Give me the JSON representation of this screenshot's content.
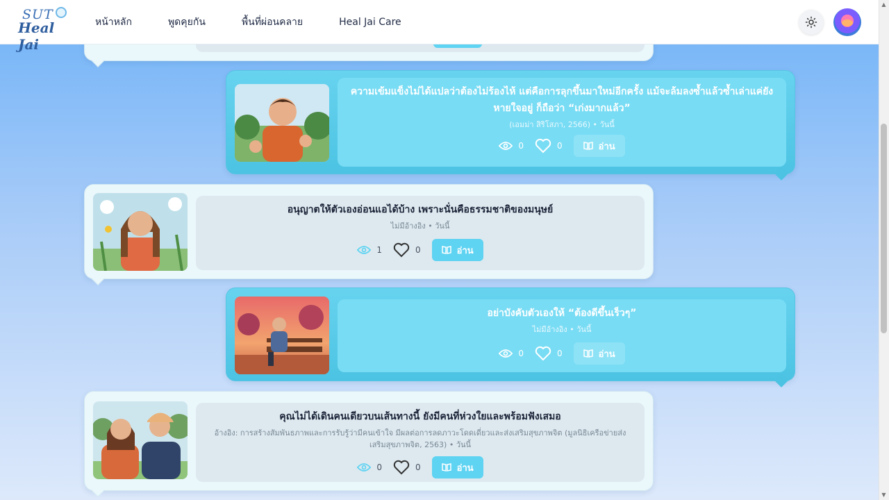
{
  "header": {
    "logo_top": "SUT",
    "logo_bottom": "Heal Jai",
    "nav": [
      "หน้าหลัก",
      "พูดคุยกัน",
      "พื้นที่ผ่อนคลาย",
      "Heal Jai Care"
    ],
    "theme_icon": "sun-icon",
    "avatar_icon": "user-avatar"
  },
  "read_label": "อ่าน",
  "cards": [
    {
      "title": "ความเข้มแข็งไม่ได้แปลว่าต้องไม่ร้องไห้ แต่คือการลุกขึ้นมาใหม่อีกครั้ง แม้จะล้มลงซ้ำแล้วซ้ำเล่าแค่ยังหายใจอยู่ ก็ถือว่า “เก่งมากแล้ว”",
      "meta": "(เอมม่า สิริโสภา, 2566) • วันนี้",
      "views": "0",
      "likes": "0"
    },
    {
      "title": "อนุญาตให้ตัวเองอ่อนแอได้บ้าง เพราะนั่นคือธรรมชาติของมนุษย์",
      "meta": "ไม่มีอ้างอิง • วันนี้",
      "views": "1",
      "likes": "0"
    },
    {
      "title": "อย่าบังคับตัวเองให้ “ต้องดีขึ้นเร็วๆ”",
      "meta": "ไม่มีอ้างอิง • วันนี้",
      "views": "0",
      "likes": "0"
    },
    {
      "title": "คุณไม่ได้เดินคนเดียวบนเส้นทางนี้ ยังมีคนที่ห่วงใยและพร้อมฟังเสมอ",
      "meta": "อ้างอิง: การสร้างสัมพันธภาพและการรับรู้ว่ามีคนเข้าใจ มีผลต่อการลดภาวะโดดเดี่ยวและส่งเสริมสุขภาพจิต (มูลนิธิเครือข่ายส่งเสริมสุขภาพจิต, 2563) • วันนี้",
      "views": "0",
      "likes": "0"
    }
  ],
  "colors": {
    "accent": "#5ed3f2",
    "right_card": "#4cc3e3",
    "left_card": "#eaf7fb"
  }
}
